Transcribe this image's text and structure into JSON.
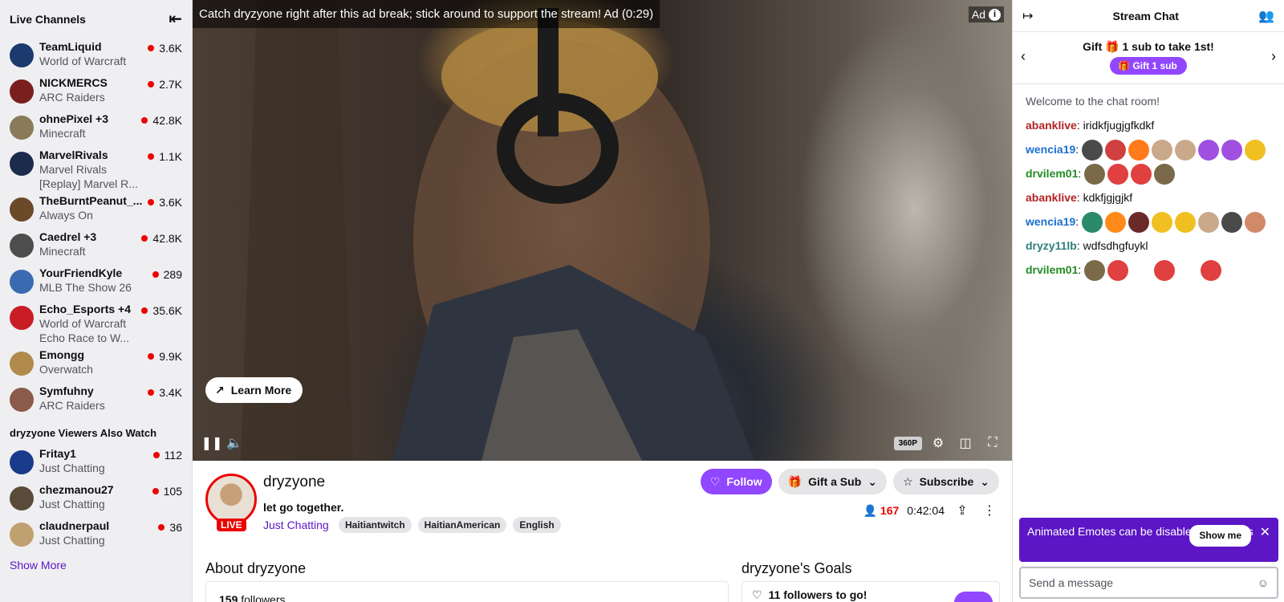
{
  "sidebar": {
    "title": "Live Channels",
    "channels": [
      {
        "name": "TeamLiquid",
        "game": "World of Warcraft",
        "viewers": "3.6K",
        "color": "#1b3a6e"
      },
      {
        "name": "NICKMERCS",
        "game": "ARC Raiders",
        "viewers": "2.7K",
        "color": "#7a1f1f"
      },
      {
        "name": "ohnePixel +3",
        "game": "Minecraft",
        "viewers": "42.8K",
        "color": "#8a7a5a"
      },
      {
        "name": "MarvelRivals",
        "game": "Marvel Rivals",
        "extra": "[Replay] Marvel R...",
        "viewers": "1.1K",
        "color": "#1c2a4d"
      },
      {
        "name": "TheBurntPeanut_...",
        "game": "Always On",
        "viewers": "3.6K",
        "color": "#6b4a2a"
      },
      {
        "name": "Caedrel +3",
        "game": "Minecraft",
        "viewers": "42.8K",
        "color": "#4d4d4d"
      },
      {
        "name": "YourFriendKyle",
        "game": "MLB The Show 26",
        "viewers": "289",
        "color": "#3a6ab0"
      },
      {
        "name": "Echo_Esports +4",
        "game": "World of Warcraft",
        "extra": "Echo Race to W...",
        "viewers": "35.6K",
        "color": "#c81d25"
      },
      {
        "name": "Emongg",
        "game": "Overwatch",
        "viewers": "9.9K",
        "color": "#b08a4a"
      },
      {
        "name": "Symfuhny",
        "game": "ARC Raiders",
        "viewers": "3.4K",
        "color": "#8a5a4a"
      }
    ],
    "also_title": "dryzyone Viewers Also Watch",
    "also": [
      {
        "name": "Fritay1",
        "game": "Just Chatting",
        "viewers": "112",
        "color": "#1a3a8a"
      },
      {
        "name": "chezmanou27",
        "game": "Just Chatting",
        "viewers": "105",
        "color": "#5a4a3a"
      },
      {
        "name": "claudnerpaul",
        "game": "Just Chatting",
        "viewers": "36",
        "color": "#c0a070"
      }
    ],
    "show_more": "Show More"
  },
  "player": {
    "ad_banner": "Catch dryzyone right after this ad break; stick around to support the stream! Ad (0:29)",
    "ad_label": "Ad",
    "learn_more": "Learn More",
    "quality": "360P"
  },
  "stream": {
    "channel": "dryzyone",
    "live": "LIVE",
    "title": "let go together.",
    "category": "Just Chatting",
    "tags": [
      "Haitiantwitch",
      "HaitianAmerican",
      "English"
    ],
    "follow": "Follow",
    "gift": "Gift a Sub",
    "subscribe": "Subscribe",
    "viewers": "167",
    "uptime": "0:42:04",
    "about_title": "About dryzyone",
    "followers_count": "159",
    "followers_label": "followers",
    "goals_title": "dryzyone's Goals",
    "goal_text": "11 followers to go!"
  },
  "chat": {
    "title": "Stream Chat",
    "gift_line_pre": "Gift",
    "gift_count": "1",
    "gift_line_post": "sub to take 1st!",
    "gift_button": "Gift 1 sub",
    "welcome": "Welcome to the chat room!",
    "messages": [
      {
        "user": "abanklive",
        "color": "#b22222",
        "text": "iridkfjugjgfkdkf",
        "emotes": []
      },
      {
        "user": "wencia19",
        "color": "#1e6fd0",
        "text": "",
        "emotes": [
          "#4a4a4a",
          "#d04040",
          "#ff7a1a",
          "#c9a98a",
          "#c9a98a",
          "#a050e0",
          "#a050e0",
          "#f0c020"
        ]
      },
      {
        "user": "drvilem01",
        "color": "#228b22",
        "text": "",
        "emotes": [
          "#7a6a4a",
          "#e04040",
          "#e04040",
          "#7a6a4a"
        ]
      },
      {
        "user": "abanklive",
        "color": "#b22222",
        "text": "kdkfjgjgjkf",
        "emotes": []
      },
      {
        "user": "wencia19",
        "color": "#1e6fd0",
        "text": "",
        "emotes": [
          "#2a8a6a",
          "#ff8a1a",
          "#6a2a2a",
          "#f0c020",
          "#f0c020",
          "#c9a98a",
          "#4a4a4a",
          "#d08a6a"
        ]
      },
      {
        "user": "dryzy11lb",
        "color": "#2e7d7d",
        "text": "wdfsdhgfuykl",
        "emotes": []
      },
      {
        "user": "drvilem01",
        "color": "#228b22",
        "text": "",
        "emotes": [
          "#7a6a4a",
          "#e04040",
          "#ffffff",
          "#e04040",
          "#ffffff",
          "#e04040"
        ]
      }
    ],
    "notice": "Animated Emotes can be disabled in Settings",
    "show_me": "Show me",
    "placeholder": "Send a message"
  }
}
